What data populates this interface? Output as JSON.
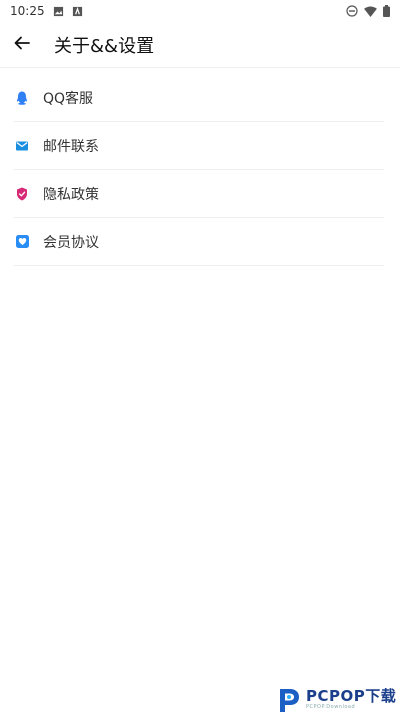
{
  "status_bar": {
    "time": "10:25"
  },
  "app_bar": {
    "title": "关于&&设置"
  },
  "menu": {
    "items": [
      {
        "label": "QQ客服",
        "icon": "qq-icon",
        "color": "#2f7ff5"
      },
      {
        "label": "邮件联系",
        "icon": "mail-icon",
        "color": "#1a8fe0"
      },
      {
        "label": "隐私政策",
        "icon": "shield-icon",
        "color": "#d62976"
      },
      {
        "label": "会员协议",
        "icon": "heart-icon",
        "color": "#2a8df5"
      }
    ]
  },
  "watermark": {
    "brand": "PCPOP下载",
    "sub": "PCPOP.Download"
  }
}
